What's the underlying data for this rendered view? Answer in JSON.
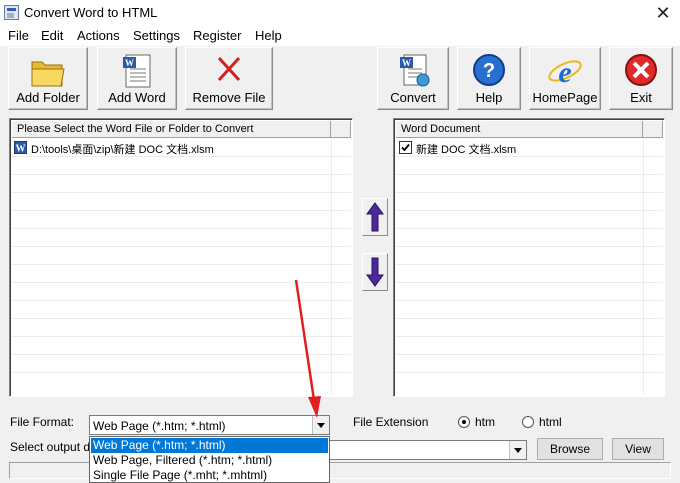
{
  "window": {
    "title": "Convert Word to HTML"
  },
  "menu": [
    "File",
    "Edit",
    "Actions",
    "Settings",
    "Register",
    "Help"
  ],
  "toolbar": {
    "add_folder": "Add Folder",
    "add_word": "Add Word",
    "remove_file": "Remove File",
    "convert": "Convert",
    "help": "Help",
    "homepage": "HomePage",
    "exit": "Exit"
  },
  "left_panel": {
    "header": "Please Select the Word File or Folder to Convert",
    "rows": [
      "D:\\tools\\桌面\\zip\\新建 DOC 文档.xlsm"
    ]
  },
  "right_panel": {
    "header": "Word Document",
    "rows": [
      {
        "name": "新建 DOC 文档.xlsm",
        "checked": true
      }
    ]
  },
  "options": {
    "file_format_label": "File Format:",
    "file_format_value": "Web Page (*.htm; *.html)",
    "file_extension_label": "File Extension",
    "ext_htm": "htm",
    "ext_html": "html",
    "ext_selected": "htm",
    "output_label": "Select  output d",
    "browse": "Browse",
    "view": "View"
  },
  "format_options": [
    "Web Page (*.htm; *.html)",
    "Web Page, Filtered (*.htm; *.html)",
    "Single File Page (*.mht; *.mhtml)"
  ],
  "colors": {
    "selection": "#0078d7",
    "arrow": "#e02020",
    "move_arrow": "#4a2a9a"
  }
}
